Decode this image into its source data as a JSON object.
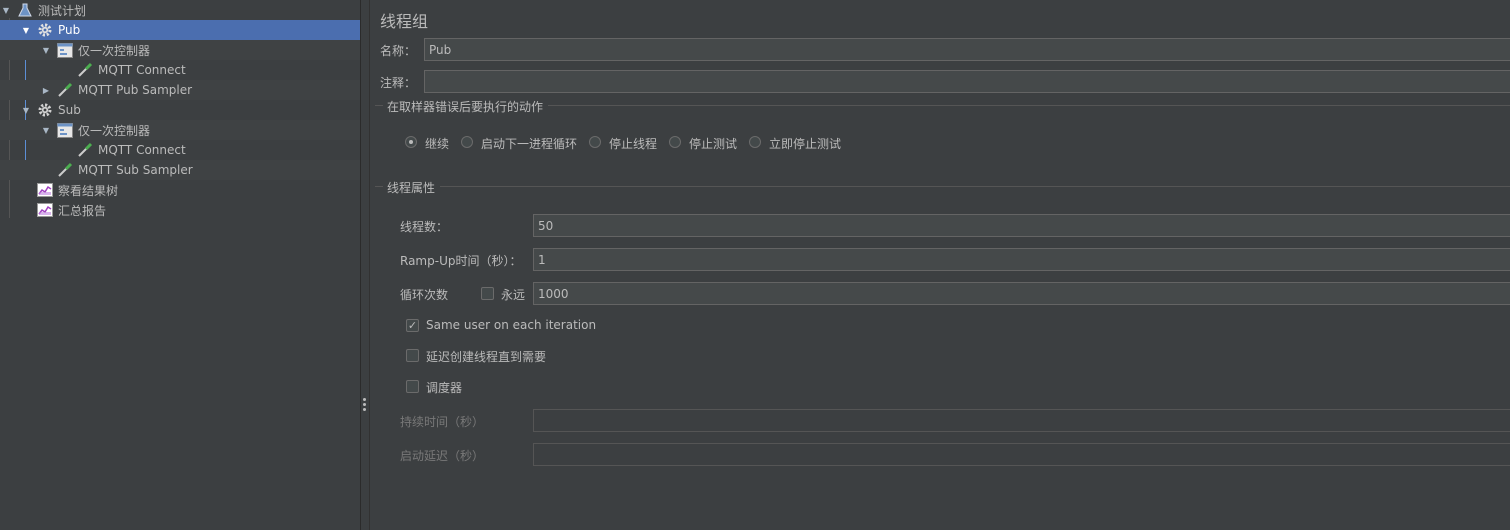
{
  "tree": {
    "items": [
      {
        "label": "测试计划",
        "icon": "test-plan-icon"
      },
      {
        "label": "Pub",
        "icon": "gear-icon"
      },
      {
        "label": "仅一次控制器",
        "icon": "controller-icon"
      },
      {
        "label": "MQTT Connect",
        "icon": "sampler-pipette-icon"
      },
      {
        "label": "MQTT Pub Sampler",
        "icon": "sampler-pipette-icon"
      },
      {
        "label": "Sub",
        "icon": "gear-icon"
      },
      {
        "label": "仅一次控制器",
        "icon": "controller-icon"
      },
      {
        "label": "MQTT Connect",
        "icon": "sampler-pipette-icon"
      },
      {
        "label": "MQTT Sub Sampler",
        "icon": "sampler-pipette-icon"
      },
      {
        "label": "察看结果树",
        "icon": "listener-chart-icon"
      },
      {
        "label": "汇总报告",
        "icon": "listener-chart-icon"
      }
    ]
  },
  "panel": {
    "title": "线程组",
    "name_label": "名称：",
    "name_value": "Pub",
    "comment_label": "注释：",
    "comment_value": "",
    "on_error": {
      "legend": "在取样器错误后要执行的动作",
      "options": [
        "继续",
        "启动下一进程循环",
        "停止线程",
        "停止测试",
        "立即停止测试"
      ],
      "selected": "继续"
    },
    "thread_props": {
      "legend": "线程属性",
      "threads_label": "线程数：",
      "threads_value": "50",
      "rampup_label": "Ramp-Up时间（秒）：",
      "rampup_value": "1",
      "loop_label": "循环次数",
      "forever_label": "永远",
      "forever_checked": false,
      "loop_value": "1000",
      "same_user_label": "Same user on each iteration",
      "same_user_checked": true,
      "delay_label": "延迟创建线程直到需要",
      "delay_checked": false,
      "scheduler_label": "调度器",
      "scheduler_checked": false,
      "duration_label": "持续时间（秒）",
      "duration_value": "",
      "startup_delay_label": "启动延迟（秒）",
      "startup_delay_value": ""
    }
  },
  "colors": {
    "background": "#3c3f41",
    "selection": "#4b6eaf",
    "field": "#45494a",
    "text": "#bbbbbb"
  }
}
